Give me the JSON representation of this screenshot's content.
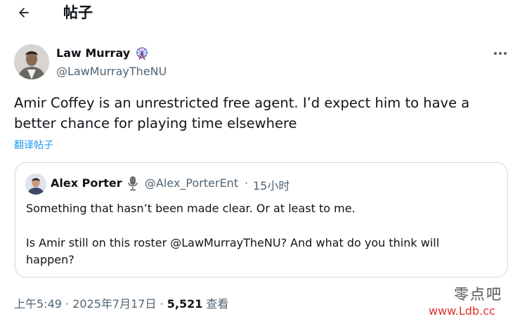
{
  "header": {
    "title": "帖子",
    "back_icon": "arrow-left-icon"
  },
  "post": {
    "author_name": "Law Murray",
    "author_badge_icon": "ferris-wheel-icon",
    "author_handle": "@LawMurrayTheNU",
    "more_icon": "more-horizontal-icon",
    "text": "Amir Coffey is an unrestricted free agent. I’d expect him to have a better chance for playing time elsewhere",
    "translate_label": "翻译帖子"
  },
  "quote": {
    "author_name": "Alex Porter",
    "author_badge_icon": "microphone-icon",
    "author_handle": "@Alex_PorterEnt",
    "separator": "·",
    "time": "15小时",
    "text_line1": "Something that hasn’t been made clear. Or at least to me.",
    "text_line2": "Is Amir still on this roster @LawMurrayTheNU? And what do you think will happen?"
  },
  "meta": {
    "time": "上午5:49",
    "separator1": " · ",
    "date": "2025年7月17日",
    "separator2": " · ",
    "views_count": "5,521",
    "views_label": " 查看"
  },
  "watermark": {
    "text": "零点吧",
    "url": "www.Ldb.cc"
  },
  "colors": {
    "text": "#0f1419",
    "secondary": "#536471",
    "link": "#1d9bf0",
    "border": "#cfd9de",
    "watermark_url": "#e0312a"
  }
}
